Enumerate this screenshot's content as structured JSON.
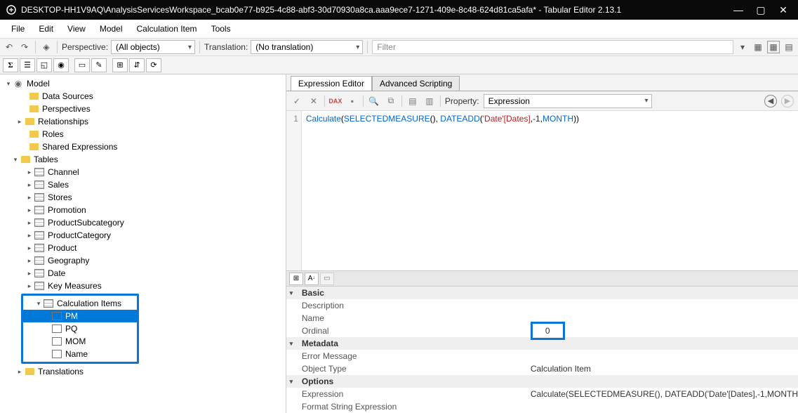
{
  "titlebar": {
    "text": "DESKTOP-HH1V9AQ\\AnalysisServicesWorkspace_bcab0e77-b925-4c88-abf3-30d70930a8ca.aaa9ece7-1271-409e-8c48-624d81ca5afa* - Tabular Editor 2.13.1"
  },
  "menubar": [
    "File",
    "Edit",
    "View",
    "Model",
    "Calculation Item",
    "Tools"
  ],
  "toolbar1": {
    "perspective_label": "Perspective:",
    "perspective_value": "(All objects)",
    "translation_label": "Translation:",
    "translation_value": "(No translation)",
    "filter_placeholder": "Filter"
  },
  "tree": {
    "root": "Model",
    "folders1": [
      "Data Sources",
      "Perspectives",
      "Relationships",
      "Roles",
      "Shared Expressions"
    ],
    "tables_label": "Tables",
    "tables": [
      "Channel",
      "Sales",
      "Stores",
      "Promotion",
      "ProductSubcategory",
      "ProductCategory",
      "Product",
      "Geography",
      "Date",
      "Key Measures"
    ],
    "calc_items_label": "Calculation Items",
    "calc_items": [
      "PM",
      "PQ",
      "MOM",
      "Name"
    ],
    "translations_label": "Translations"
  },
  "tabs": {
    "expr": "Expression Editor",
    "adv": "Advanced Scripting"
  },
  "editor_toolbar": {
    "property_label": "Property:",
    "property_value": "Expression"
  },
  "code": {
    "line": "1",
    "tokens": {
      "calculate": "Calculate",
      "selmeas": "SELECTEDMEASURE",
      "dateadd": "DATEADD",
      "ref": "'Date'[Dates]",
      "neg1": "-1",
      "month": "MONTH"
    }
  },
  "props": {
    "basic": "Basic",
    "description": "Description",
    "name": "Name",
    "ordinal": "Ordinal",
    "ordinal_val": "0",
    "metadata": "Metadata",
    "error_message": "Error Message",
    "object_type": "Object Type",
    "object_type_val": "Calculation Item",
    "options": "Options",
    "expression": "Expression",
    "expression_val": "Calculate(SELECTEDMEASURE(), DATEADD('Date'[Dates],-1,MONTH",
    "format_string": "Format String Expression"
  }
}
